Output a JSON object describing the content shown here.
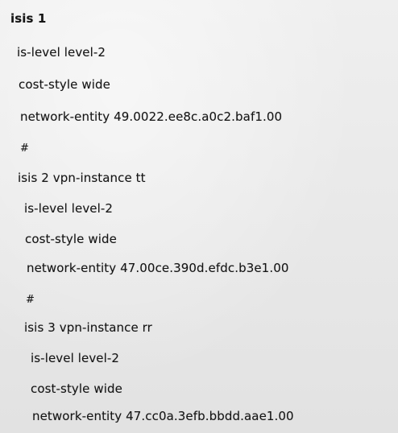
{
  "config": {
    "lines": [
      "isis 1",
      "is-level level-2",
      "cost-style wide",
      "network-entity 49.0022.ee8c.a0c2.baf1.00",
      "#",
      "isis 2 vpn-instance tt",
      "is-level level-2",
      "cost-style wide",
      "network-entity 47.00ce.390d.efdc.b3e1.00",
      "#",
      "isis 3 vpn-instance rr",
      "is-level level-2",
      "cost-style wide",
      "network-entity 47.cc0a.3efb.bbdd.aae1.00"
    ]
  }
}
